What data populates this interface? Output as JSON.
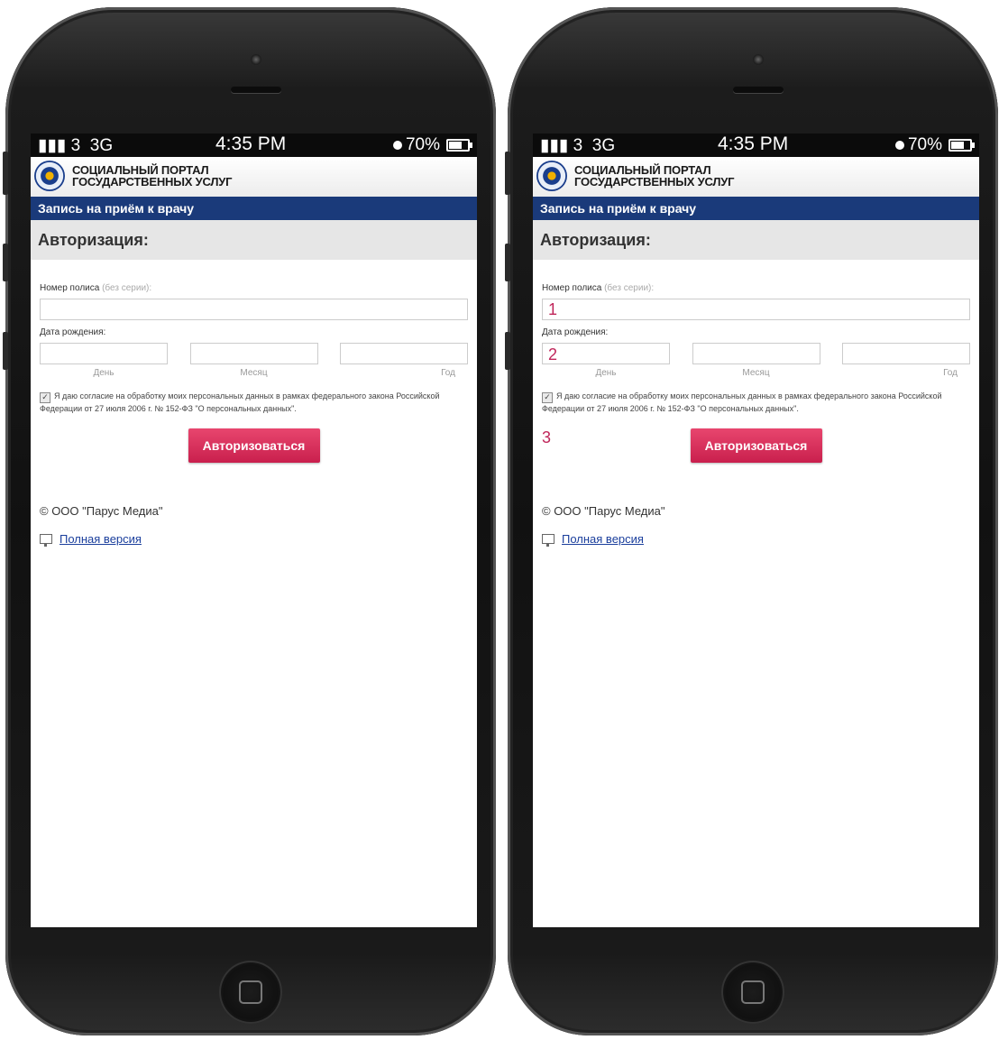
{
  "phones": [
    {
      "status": {
        "carrier": "3",
        "network": "3G",
        "time": "4:35 PM",
        "battery": "70%",
        "battery_level": 0.7
      },
      "portal": {
        "title_line1": "СОЦИАЛЬНЫЙ ПОРТАЛ",
        "title_line2": "ГОСУДАРСТВЕННЫХ УСЛУГ"
      },
      "nav_title": "Запись на приём к врачу",
      "section_title": "Авторизация:",
      "policy": {
        "label": "Номер полиса",
        "hint": "(без серии):",
        "value": ""
      },
      "birth": {
        "label": "Дата рождения:",
        "day_label": "День",
        "month_label": "Месяц",
        "year_label": "Год",
        "day_value": "",
        "month_value": "",
        "year_value": ""
      },
      "consent": {
        "checked": true,
        "text": "Я даю согласие на обработку моих персональных данных в рамках федерального закона Российской Федерации от 27 июля 2006 г. № 152-ФЗ \"О персональных данных\"."
      },
      "marker3": "",
      "submit_label": "Авторизоваться",
      "copyright": "© ООО \"Парус Медиа\"",
      "full_version": "Полная версия"
    },
    {
      "status": {
        "carrier": "3",
        "network": "3G",
        "time": "4:35 PM",
        "battery": "70%",
        "battery_level": 0.7
      },
      "portal": {
        "title_line1": "СОЦИАЛЬНЫЙ ПОРТАЛ",
        "title_line2": "ГОСУДАРСТВЕННЫХ УСЛУГ"
      },
      "nav_title": "Запись на приём к врачу",
      "section_title": "Авторизация:",
      "policy": {
        "label": "Номер полиса",
        "hint": "(без серии):",
        "value": "1"
      },
      "birth": {
        "label": "Дата рождения:",
        "day_label": "День",
        "month_label": "Месяц",
        "year_label": "Год",
        "day_value": "2",
        "month_value": "",
        "year_value": ""
      },
      "consent": {
        "checked": true,
        "text": "Я даю согласие на обработку моих персональных данных в рамках федерального закона Российской Федерации от 27 июля 2006 г. № 152-ФЗ \"О персональных данных\"."
      },
      "marker3": "3",
      "submit_label": "Авторизоваться",
      "copyright": "© ООО \"Парус Медиа\"",
      "full_version": "Полная версия"
    }
  ]
}
